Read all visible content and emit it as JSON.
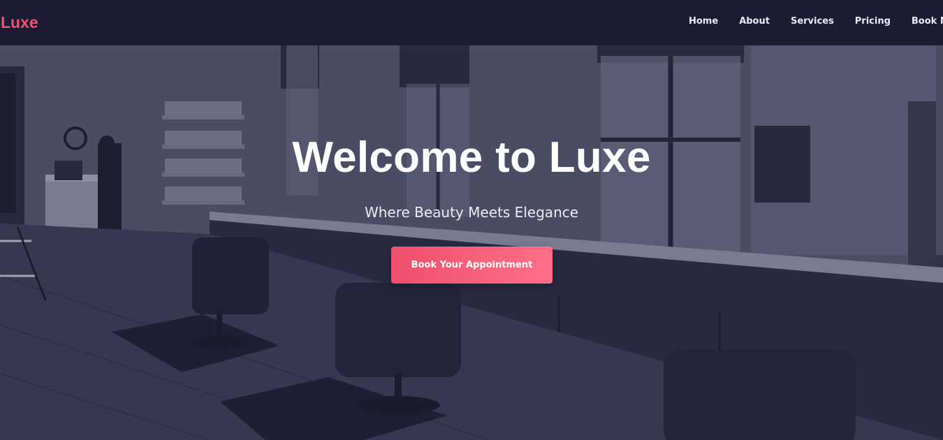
{
  "brand": {
    "name": "Luxe",
    "color": "#f0506e"
  },
  "nav": {
    "items": [
      {
        "label": "Home"
      },
      {
        "label": "About"
      },
      {
        "label": "Services"
      },
      {
        "label": "Pricing"
      },
      {
        "label": "Book Now"
      }
    ]
  },
  "hero": {
    "title": "Welcome to Luxe",
    "subtitle": "Where Beauty Meets Elegance",
    "cta_label": "Book Your Appointment",
    "cta_gradient": [
      "#ee4f6d",
      "#ff6f88"
    ],
    "background_image": "salon-interior-photo"
  },
  "colors": {
    "navbar_bg": "#1c1b34",
    "overlay": "#1c1b34",
    "nav_text": "#eceaf2"
  }
}
